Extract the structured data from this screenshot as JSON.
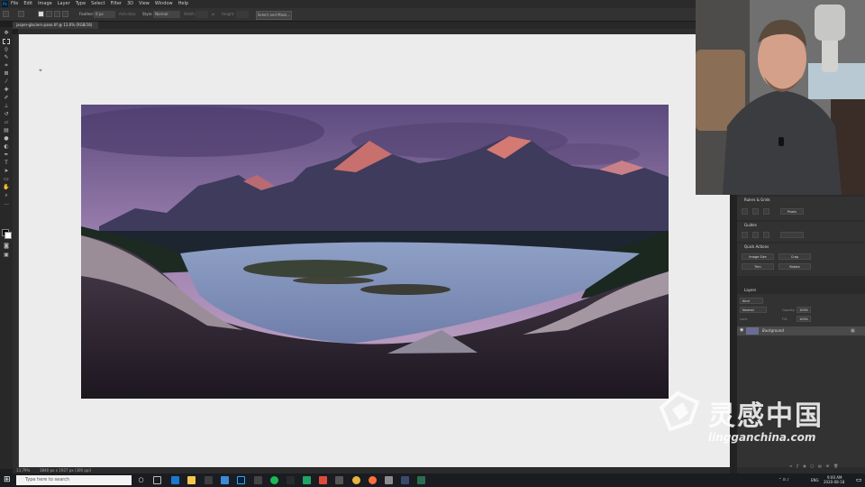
{
  "app": {
    "name": "Photoshop",
    "logo": "Ps"
  },
  "menubar": {
    "items": [
      "File",
      "Edit",
      "Image",
      "Layer",
      "Type",
      "Select",
      "Filter",
      "3D",
      "View",
      "Window",
      "Help"
    ]
  },
  "options_bar": {
    "feather_label": "Feather:",
    "feather_value": "0 px",
    "antialias_label": "Anti-alias",
    "style_label": "Style:",
    "style_value": "Normal",
    "width_label": "Width:",
    "height_label": "Height:",
    "select_mask_button": "Select and Mask..."
  },
  "document": {
    "tab_title": "jasper-glaciers-pano.tif @ 13.6% (RGB/16)",
    "status_zoom": "13.79%",
    "status_info": "3840 px x 1927 px (300 ppi)"
  },
  "panels": {
    "rulers_grids": {
      "title": "Rulers & Grids",
      "unit": "Pixels"
    },
    "guides": {
      "title": "Guides"
    },
    "quick_actions": {
      "title": "Quick Actions",
      "buttons": [
        "Image Size",
        "Crop",
        "Trim",
        "Rotate"
      ]
    },
    "layers": {
      "title": "Layers",
      "kind_label": "Kind",
      "blend_mode": "Normal",
      "opacity_label": "Opacity:",
      "opacity_value": "100%",
      "lock_label": "Lock:",
      "fill_label": "Fill:",
      "fill_value": "100%",
      "layer_name": "Background"
    }
  },
  "taskbar": {
    "search_placeholder": "Type here to search",
    "time": "9:00 AM",
    "date": "2020-08-18",
    "language": "ENG"
  },
  "watermark": {
    "text_cn": "灵感中国",
    "text_url": "lingganchina.com"
  },
  "colors": {
    "accent": "#31a8ff",
    "canvas_bg": "#ececec",
    "panel_bg": "#323232",
    "taskbar": "#1a1c22"
  }
}
